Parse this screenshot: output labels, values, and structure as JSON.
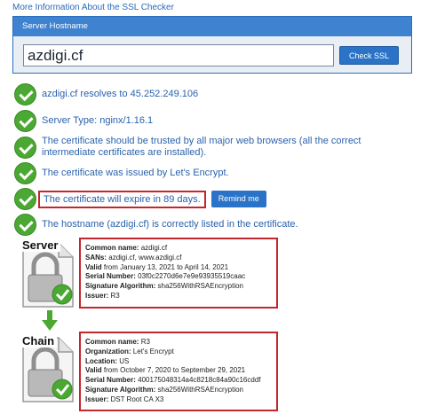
{
  "top_link": "More Information About the SSL Checker",
  "panel": {
    "title": "Server Hostname",
    "hostname_value": "azdigi.cf",
    "check_button": "Check SSL"
  },
  "results": [
    {
      "text": "azdigi.cf resolves to 45.252.249.106"
    },
    {
      "text": "Server Type: nginx/1.16.1"
    },
    {
      "text": "The certificate should be trusted by all major web browsers (all the correct intermediate certificates are installed)."
    },
    {
      "text": "The certificate was issued by Let's Encrypt."
    },
    {
      "text": "The certificate will expire in 89 days.",
      "button": "Remind me"
    },
    {
      "text": "The hostname (azdigi.cf) is correctly listed in the certificate."
    }
  ],
  "server_cert": {
    "label": "Server",
    "common_name_label": "Common name:",
    "common_name": "azdigi.cf",
    "sans_label": "SANs:",
    "sans": "azdigi.cf, www.azdigi.cf",
    "valid_label": "Valid",
    "valid": "from January 13, 2021 to April 14, 2021",
    "serial_label": "Serial Number:",
    "serial": "03f0c2270d6e7e9e93935519caac",
    "sigalg_label": "Signature Algorithm:",
    "sigalg": "sha256WithRSAEncryption",
    "issuer_label": "Issuer:",
    "issuer": "R3"
  },
  "chain_cert": {
    "label": "Chain",
    "common_name_label": "Common name:",
    "common_name": "R3",
    "org_label": "Organization:",
    "org": "Let's Encrypt",
    "location_label": "Location:",
    "location": "US",
    "valid_label": "Valid",
    "valid": "from October 7, 2020 to September 29, 2021",
    "serial_label": "Serial Number:",
    "serial": "400175048314a4c8218c84a90c16cddf",
    "sigalg_label": "Signature Algorithm:",
    "sigalg": "sha256WithRSAEncryption",
    "issuer_label": "Issuer:",
    "issuer": "DST Root CA X3"
  },
  "colors": {
    "accent": "#2b73c7",
    "ok": "#4aa833",
    "highlight": "#c4262e"
  },
  "icons": {
    "status": "checkmark-icon",
    "certificate": "padlock-icon"
  }
}
